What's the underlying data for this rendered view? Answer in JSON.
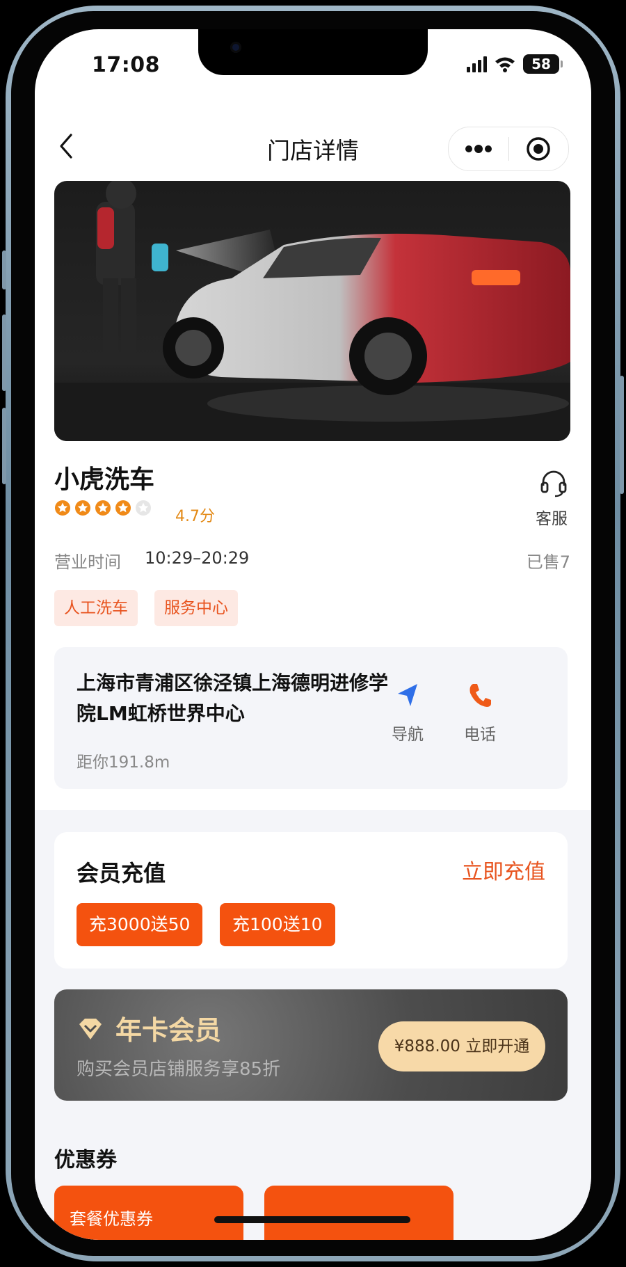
{
  "status_bar": {
    "time": "17:08",
    "battery": "58"
  },
  "navbar": {
    "title": "门店详情"
  },
  "store": {
    "name": "小虎洗车",
    "rating_stars": 4,
    "rating_max": 5,
    "rating_text": "4.7分",
    "customer_service_label": "客服",
    "hours_label": "营业时间",
    "hours_value": "10:29–20:29",
    "sold": "已售7",
    "tags": [
      "人工洗车",
      "服务中心"
    ]
  },
  "address": {
    "text": "上海市青浦区徐泾镇上海德明进修学院LM虹桥世界中心",
    "distance": "距你191.8m",
    "nav_label": "导航",
    "phone_label": "电话"
  },
  "member": {
    "title": "会员充值",
    "action": "立即充值",
    "options": [
      "充3000送50",
      "充100送10"
    ]
  },
  "year_card": {
    "title": "年卡会员",
    "subtitle": "购买会员店铺服务享85折",
    "button": "¥888.00 立即开通"
  },
  "coupons": {
    "title": "优惠券",
    "items": [
      "套餐优惠券",
      "..."
    ]
  },
  "colors": {
    "accent": "#f4520f",
    "tag_bg": "#fde9e3",
    "star": "#f08a18",
    "nav_blue": "#2f6fe8",
    "phone_orange": "#ef5a18"
  }
}
